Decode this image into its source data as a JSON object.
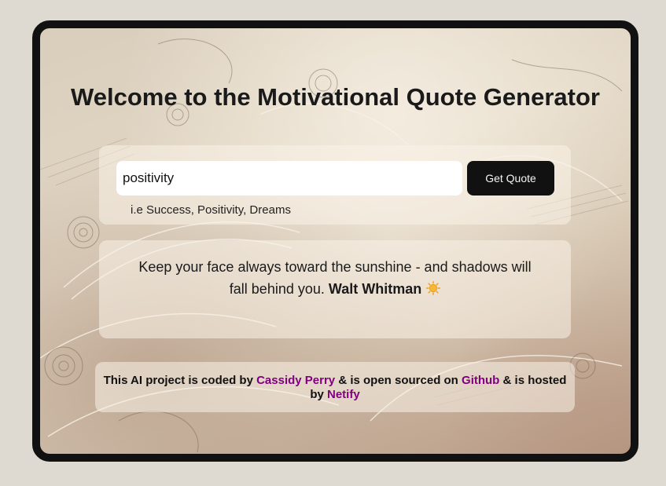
{
  "title": "Welcome to the Motivational Quote Generator",
  "search": {
    "value": "positivity",
    "placeholder": "",
    "button_label": "Get Quote",
    "hint": "i.e Success, Positivity, Dreams"
  },
  "quote": {
    "text": "Keep your face always toward the sunshine - and shadows will fall behind you.",
    "author": "Walt Whitman",
    "icon": "sun-icon"
  },
  "footer": {
    "part1": "This AI project is coded by",
    "author_link": "Cassidy Perry",
    "part2": "& is open sourced on",
    "github_link": "Github",
    "part3": "& is hosted by",
    "host_link": "Netify"
  },
  "colors": {
    "link": "#800080",
    "button_bg": "#111111",
    "frame_border": "#111111",
    "page_bg": "#dedad1"
  }
}
